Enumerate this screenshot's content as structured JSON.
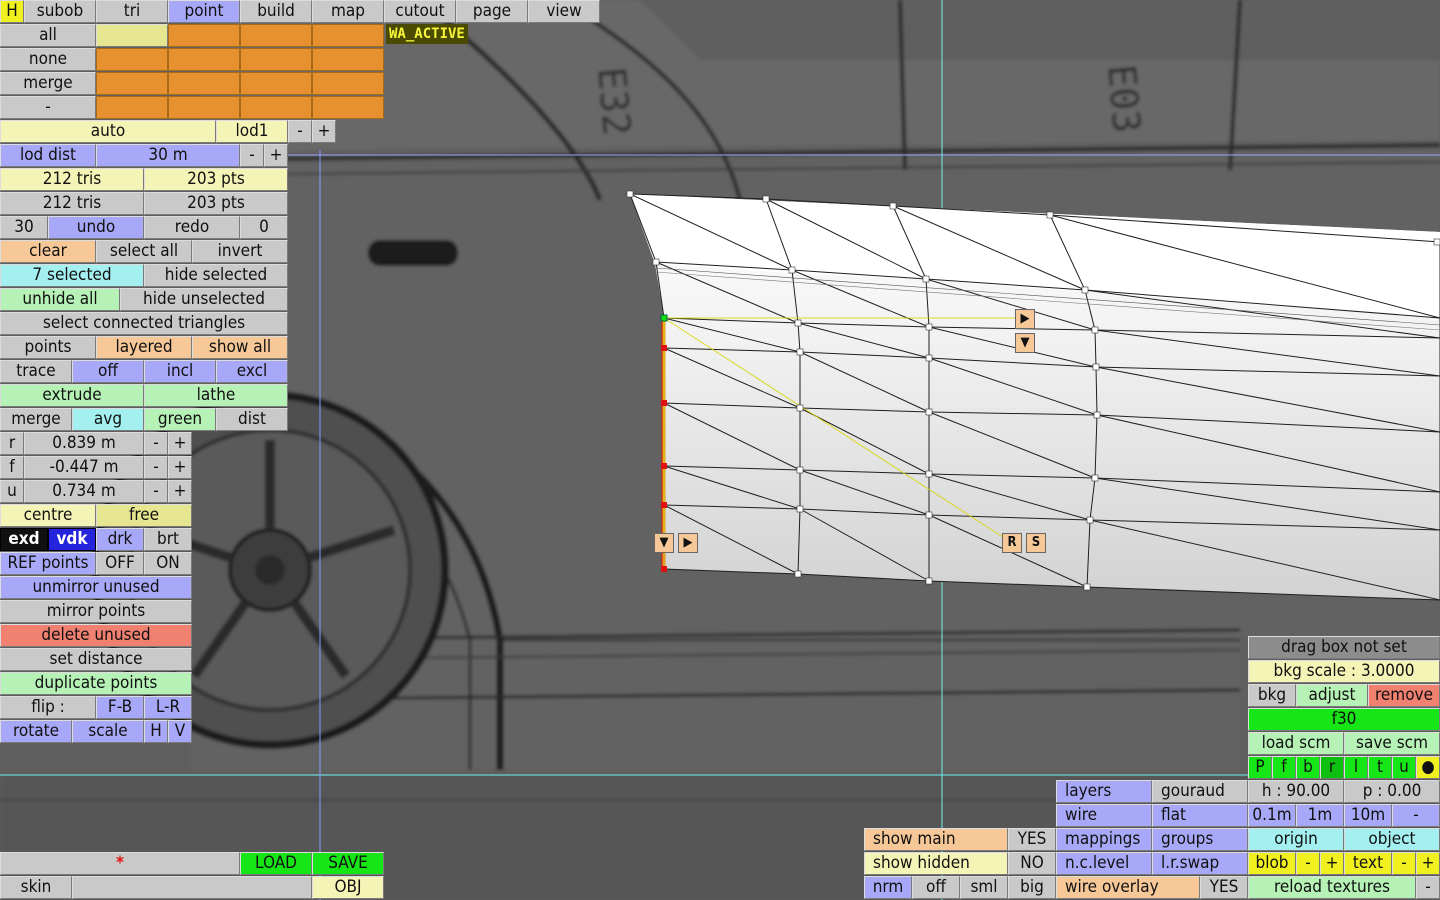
{
  "tabs": [
    "H",
    "subob",
    "tri",
    "point",
    "build",
    "map",
    "cutout",
    "page",
    "view"
  ],
  "selection_rows": [
    "all",
    "none",
    "merge",
    "-"
  ],
  "status_tag": "WA_ACTIVE",
  "lod": {
    "auto": "auto",
    "name": "lod1",
    "minus": "-",
    "plus": "+",
    "dist_label": "lod dist",
    "dist_value": "30 m"
  },
  "counts": {
    "tris1": "212 tris",
    "pts1": "203 pts",
    "tris2": "212 tris",
    "pts2": "203 pts"
  },
  "undo": {
    "left_count": "30",
    "undo": "undo",
    "redo": "redo",
    "right_count": "0"
  },
  "select": {
    "clear": "clear",
    "select_all": "select all",
    "invert": "invert",
    "selected": "7 selected",
    "hide_selected": "hide selected",
    "unhide_all": "unhide all",
    "hide_unselected": "hide unselected",
    "connected": "select connected triangles"
  },
  "modes": {
    "points": "points",
    "layered": "layered",
    "show_all": "show all",
    "trace": "trace",
    "off": "off",
    "incl": "incl",
    "excl": "excl",
    "extrude": "extrude",
    "lathe": "lathe",
    "merge": "merge",
    "avg": "avg",
    "green": "green",
    "dist": "dist"
  },
  "coords": [
    {
      "label": "r",
      "value": "0.839 m"
    },
    {
      "label": "f",
      "value": "-0.447 m"
    },
    {
      "label": "u",
      "value": "0.734 m"
    }
  ],
  "pivot": {
    "centre": "centre",
    "free": "free"
  },
  "render_mode": {
    "exd": "exd",
    "vdk": "vdk",
    "drk": "drk",
    "brt": "brt"
  },
  "ref": {
    "label": "REF points",
    "off": "OFF",
    "on": "ON"
  },
  "ops": {
    "unmirror": "unmirror unused",
    "mirror": "mirror points",
    "delete": "delete unused",
    "set_distance": "set distance",
    "duplicate": "duplicate points",
    "flip": "flip :",
    "fb": "F-B",
    "lr": "L-R",
    "rotate": "rotate",
    "scale": "scale",
    "h": "H",
    "v": "V"
  },
  "file": {
    "modified": "*",
    "load": "LOAD",
    "save": "SAVE",
    "skin": "skin",
    "obj": "OBJ"
  },
  "handles": {
    "r": "R",
    "s": "S",
    "right": "▶",
    "down": "▼"
  },
  "bkg": {
    "drag_box": "drag box not set",
    "scale": "bkg scale : 3.0000",
    "bkg": "bkg",
    "adjust": "adjust",
    "remove": "remove",
    "frame": "f30",
    "load_scm": "load scm",
    "save_scm": "save scm"
  },
  "views": [
    "P",
    "f",
    "b",
    "r",
    "l",
    "t",
    "u",
    "●"
  ],
  "camera": {
    "h": "h : 90.00",
    "p": "p : 0.00",
    "step1": "0.1m",
    "step2": "1m",
    "step3": "10m",
    "minus": "-",
    "origin": "origin",
    "object": "object",
    "blob": "blob",
    "text": "text",
    "reload": "reload textures"
  },
  "display": {
    "show_main": "show main",
    "show_main_val": "YES",
    "show_hidden": "show hidden",
    "show_hidden_val": "NO",
    "nrm": "nrm",
    "off": "off",
    "sml": "sml",
    "big": "big",
    "layers": "layers",
    "gouraud": "gouraud",
    "wire": "wire",
    "flat": "flat",
    "mappings": "mappings",
    "groups": "groups",
    "nclevel": "n.c.level",
    "lrswap": "l.r.swap",
    "wire_overlay": "wire overlay",
    "wire_overlay_val": "YES"
  },
  "colors": {
    "accent_blue": "#a8a8f8",
    "orange": "#e69030",
    "bright_green": "#16e616",
    "selection_red": "#e01010"
  }
}
